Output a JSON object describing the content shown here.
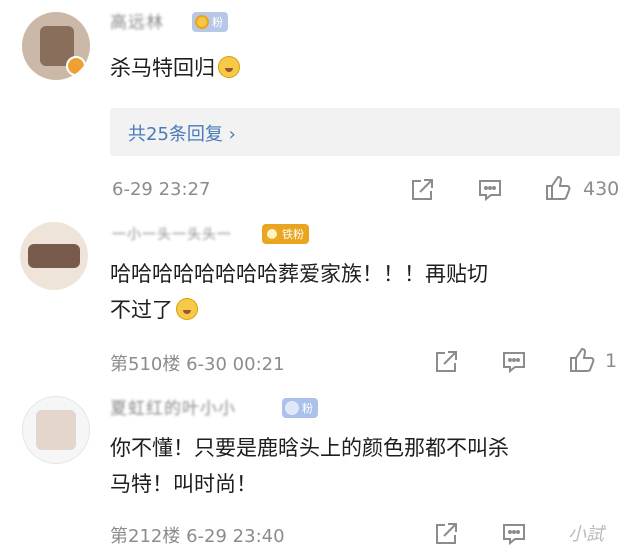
{
  "comments": [
    {
      "username": "高远林",
      "badge": "粉",
      "text_line1": "杀马特回归",
      "text_line2": "",
      "replies_label": "共25条回复",
      "replies_chevron": "›",
      "floor": "",
      "timestamp": "6-29 23:27",
      "likes": "430"
    },
    {
      "username": "一小一头一头头一",
      "badge": "铁粉",
      "text_line1": "哈哈哈哈哈哈哈哈葬爱家族！！！再贴切",
      "text_line2": "不过了",
      "floor": "第510楼",
      "timestamp": "6-30 00:21",
      "likes": "1"
    },
    {
      "username": "夏虹红的叶小小",
      "badge": "粉",
      "text_line1": "你不懂！只要是鹿晗头上的颜色那都不叫杀",
      "text_line2": "马特！叫时尚！",
      "floor": "第212楼",
      "timestamp": "6-29 23:40",
      "likes": ""
    }
  ],
  "icons": {
    "share": "share-icon",
    "reply": "comment-icon",
    "like": "thumbs-up-icon"
  },
  "colors": {
    "link": "#4a7ab8",
    "meta": "#8c8c8c",
    "badge_blue": "#6f9fe0",
    "badge_gold": "#e9a520"
  },
  "watermark": "小試"
}
